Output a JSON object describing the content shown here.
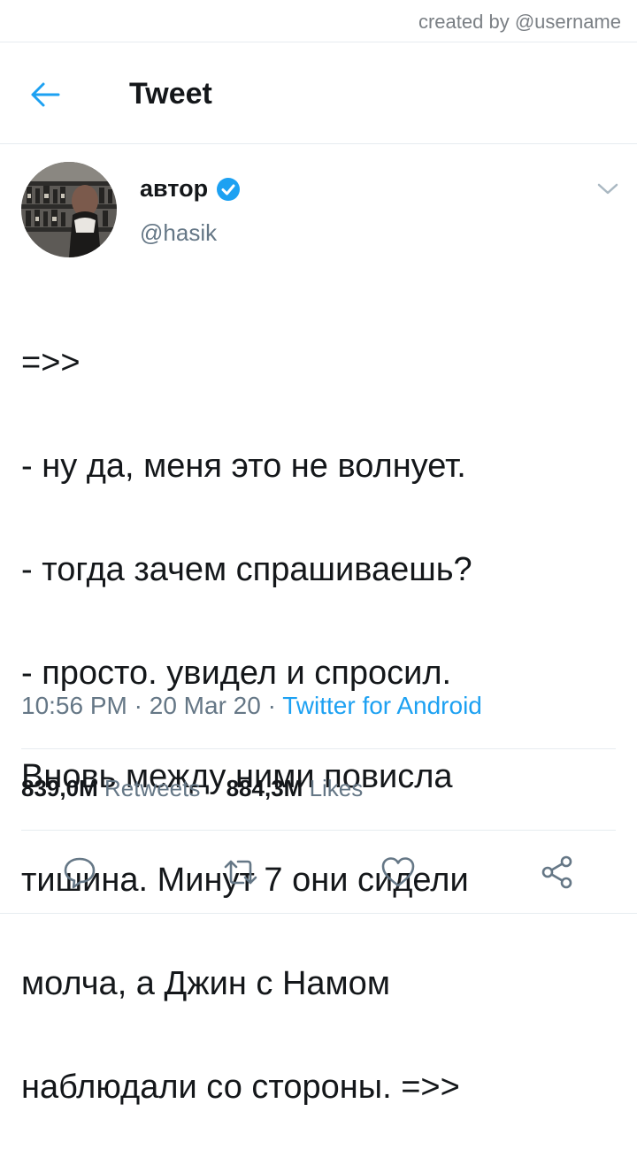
{
  "credit": "created by @username",
  "header": {
    "title": "Tweet",
    "back_icon": "arrow-left-icon"
  },
  "author": {
    "name": "автор",
    "handle": "@hasik",
    "verified_icon": "verified-badge-icon"
  },
  "tweet": {
    "lines": [
      "=>>",
      "- ну да, меня это не волнует.",
      "- тогда зачем спрашиваешь?",
      "- просто. увидел и спросил.",
      "Вновь между ними повисла",
      "тишина. Минут 7 они сидели",
      "молча, а Джин с Намом",
      "наблюдали со стороны.  =>>"
    ],
    "time": "10:56 PM",
    "date": "20 Mar 20",
    "sep": "·",
    "source": "Twitter for Android"
  },
  "stats": {
    "retweets_count": "839,0M",
    "retweets_label": "Retweets",
    "likes_count": "884,3M",
    "likes_label": "Likes"
  },
  "actions": [
    "reply-icon",
    "retweet-icon",
    "like-icon",
    "share-icon"
  ],
  "colors": {
    "accent": "#1da1f2",
    "text": "#14171a",
    "muted": "#657786",
    "divider": "#e6ecf0"
  }
}
